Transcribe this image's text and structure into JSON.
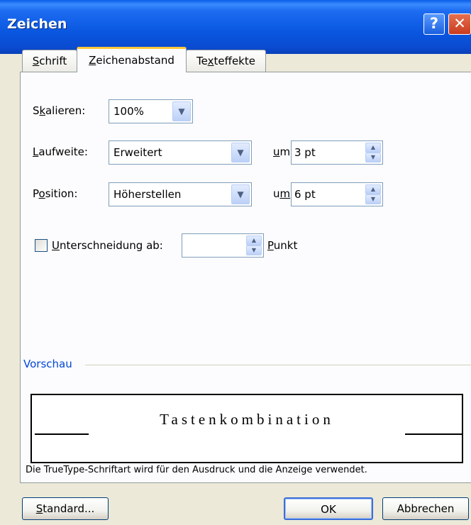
{
  "window": {
    "title": "Zeichen",
    "help_glyph": "?",
    "close_glyph": "✕"
  },
  "tabs": [
    {
      "label": "Schrift",
      "mnemonic": "S",
      "rest": "chrift"
    },
    {
      "label": "Zeichenabstand",
      "pre": "",
      "mnemonic": "Z",
      "rest": "eichenabstand",
      "active": true
    },
    {
      "label": "Texteffekte",
      "pre": "Te",
      "mnemonic": "x",
      "rest": "teffekte"
    }
  ],
  "fields": {
    "skalieren": {
      "label_pre": "S",
      "label_mn": "k",
      "label_rest": "alieren:",
      "value": "100%"
    },
    "laufweite": {
      "label_mn": "L",
      "label_rest": "aufweite:",
      "value": "Erweitert",
      "um_label_mn": "u",
      "um_label_rest": "m:",
      "um_value": "3 pt"
    },
    "position": {
      "label_pre": "P",
      "label_mn": "o",
      "label_rest": "sition:",
      "value": "Höherstellen",
      "um_label_pre": "u",
      "um_label_mn": "m",
      "um_label_rest": ":",
      "um_value": "6 pt"
    },
    "unterschneidung": {
      "label_mn": "U",
      "label_rest": "nterschneidung ab:",
      "checked": false,
      "value": "",
      "unit_mn": "P",
      "unit_rest": "unkt"
    }
  },
  "preview": {
    "group_label": "Vorschau",
    "sample_text": "Tastenkombination"
  },
  "footnote": "Die TrueType-Schriftart wird für den Ausdruck und die Anzeige verwendet.",
  "buttons": {
    "standard": {
      "mn": "S",
      "rest": "tandard..."
    },
    "ok": "OK",
    "cancel": "Abbrechen"
  },
  "colors": {
    "title_bar": "#0a56e0",
    "tab_highlight": "#ffc83c",
    "group_label": "#0046d5"
  },
  "icons": {
    "dropdown": "chevron-down-icon",
    "spin_up": "chevron-up-icon",
    "spin_down": "chevron-down-icon"
  }
}
